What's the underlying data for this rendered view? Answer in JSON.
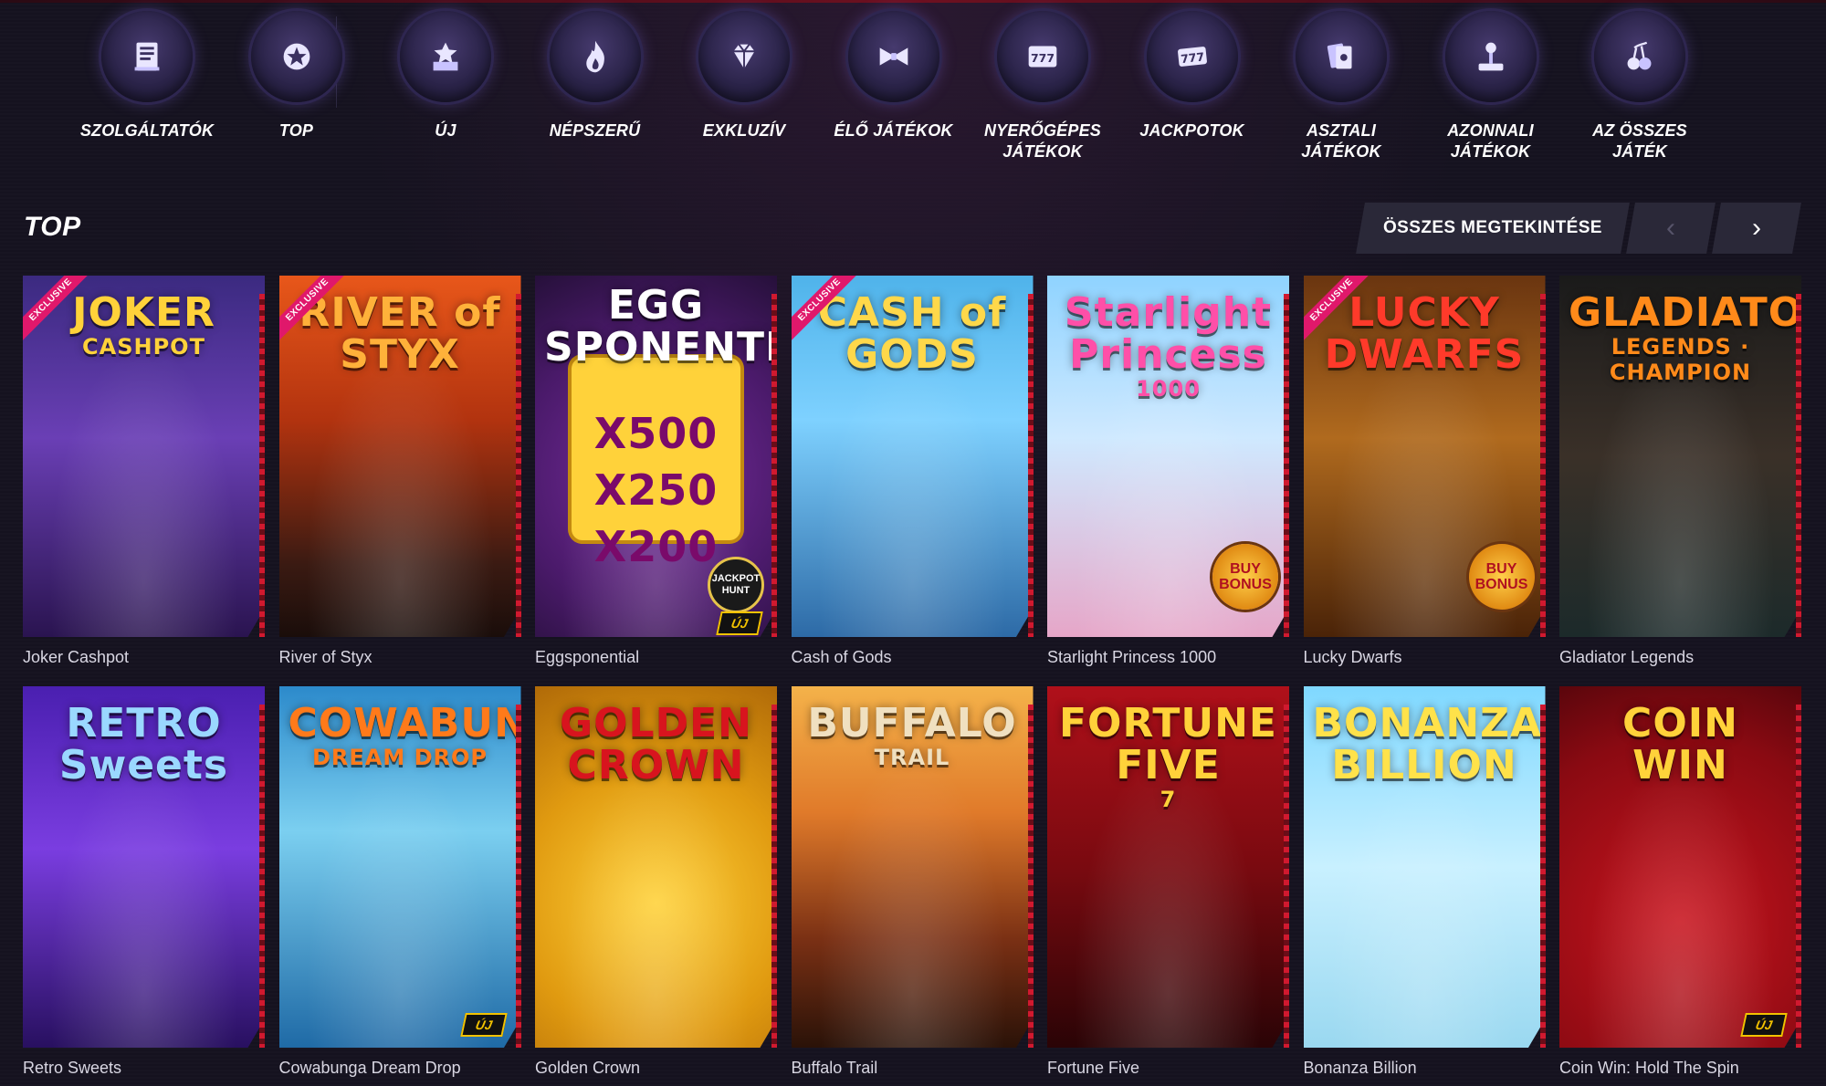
{
  "categories": [
    {
      "label": "SZOLGÁLTATÓK",
      "icon": "book-icon"
    },
    {
      "label": "TOP",
      "icon": "star-badge-icon"
    },
    {
      "label": "ÚJ",
      "icon": "new-box-icon"
    },
    {
      "label": "NÉPSZERŰ",
      "icon": "flame-icon"
    },
    {
      "label": "EXKLUZÍV",
      "icon": "diamond-icon"
    },
    {
      "label": "ÉLŐ JÁTÉKOK",
      "icon": "bowtie-icon"
    },
    {
      "label": "NYERŐGÉPES JÁTÉKOK",
      "icon": "slot-777-icon"
    },
    {
      "label": "JACKPOTOK",
      "icon": "jackpot-777-icon"
    },
    {
      "label": "ASZTALI JÁTÉKOK",
      "icon": "cards-icon"
    },
    {
      "label": "AZONNALI JÁTÉKOK",
      "icon": "joystick-icon"
    },
    {
      "label": "AZ ÖSSZES JÁTÉK",
      "icon": "cherries-icon"
    }
  ],
  "section": {
    "title": "TOP",
    "view_all_label": "ÖSSZES MEGTEKINTÉSE",
    "prev_icon": "‹",
    "next_icon": "›"
  },
  "games": [
    {
      "name": "Joker Cashpot",
      "tile_title": "JOKER",
      "tile_sub": "CASHPOT",
      "exclusive": "EXCLUSIVE",
      "theme": "t-joker"
    },
    {
      "name": "River of Styx",
      "tile_title": "RIVER of STYX",
      "tile_sub": "",
      "exclusive": "EXCLUSIVE",
      "theme": "t-styx"
    },
    {
      "name": "Eggsponential",
      "tile_title": "EGG SPONENTIAL",
      "tile_sub": "X500 X250 X200",
      "badge_jp": "JACKPOT HUNT",
      "badge_new": "ÚJ",
      "theme": "t-egg"
    },
    {
      "name": "Cash of Gods",
      "tile_title": "CASH of GODS",
      "tile_sub": "",
      "exclusive": "EXCLUSIVE",
      "theme": "t-gods"
    },
    {
      "name": "Starlight Princess 1000",
      "tile_title": "Starlight Princess",
      "tile_sub": "1000",
      "badge_buy": "BUY BONUS",
      "theme": "t-star"
    },
    {
      "name": "Lucky Dwarfs",
      "tile_title": "LUCKY DWARFS",
      "tile_sub": "",
      "exclusive": "EXCLUSIVE",
      "badge_buy": "BUY BONUS",
      "theme": "t-dwarf"
    },
    {
      "name": "Gladiator Legends",
      "tile_title": "GLADIATOR",
      "tile_sub": "LEGENDS · CHAMPION",
      "theme": "t-glad"
    },
    {
      "name": "Retro Sweets",
      "tile_title": "RETRO Sweets",
      "tile_sub": "",
      "theme": "t-retro"
    },
    {
      "name": "Cowabunga Dream Drop",
      "tile_title": "COWABUNGA",
      "tile_sub": "DREAM DROP",
      "badge_new": "ÚJ",
      "theme": "t-cowa"
    },
    {
      "name": "Golden Crown",
      "tile_title": "GOLDEN CROWN",
      "tile_sub": "",
      "theme": "t-golden"
    },
    {
      "name": "Buffalo Trail",
      "tile_title": "BUFFALO",
      "tile_sub": "TRAIL",
      "theme": "t-buff"
    },
    {
      "name": "Fortune Five",
      "tile_title": "FORTUNE FIVE",
      "tile_sub": "7",
      "theme": "t-five"
    },
    {
      "name": "Bonanza Billion",
      "tile_title": "BONANZA BILLION",
      "tile_sub": "",
      "theme": "t-bonanza"
    },
    {
      "name": "Coin Win: Hold The Spin",
      "tile_title": "COIN WIN",
      "tile_sub": "",
      "badge_new": "ÚJ",
      "theme": "t-coin"
    }
  ],
  "colors": {
    "background": "#15121f",
    "accent_red": "#d1192f",
    "exclusive_pink": "#e0186b",
    "new_badge_yellow": "#f2c200",
    "button_bg": "#2a2838"
  }
}
